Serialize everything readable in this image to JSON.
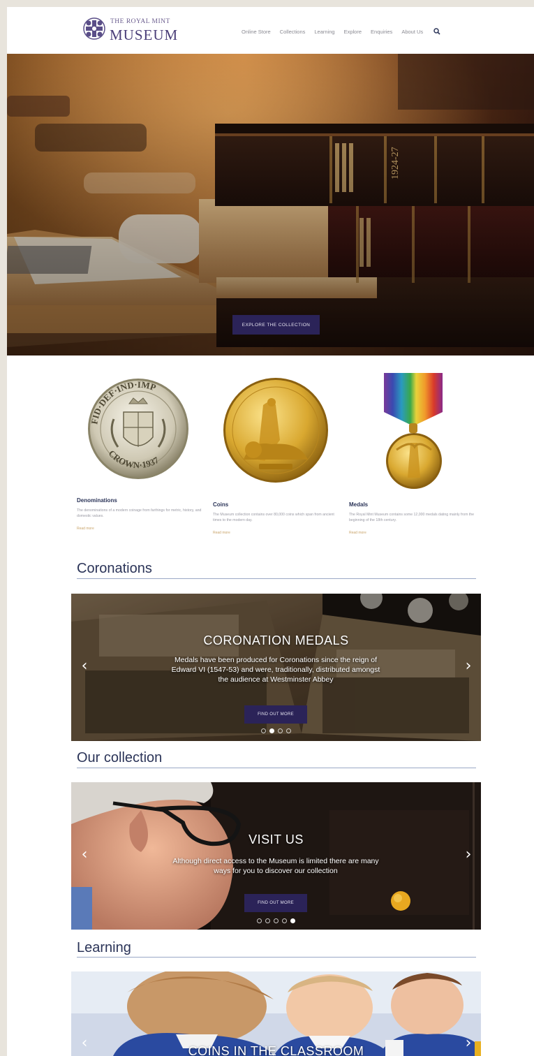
{
  "header": {
    "logo_small": "THE ROYAL MINT",
    "logo_big": "MUSEUM",
    "nav": [
      "Online Store",
      "Collections",
      "Learning",
      "Explore",
      "Enquiries",
      "About Us"
    ],
    "search_icon": "search-icon"
  },
  "hero": {
    "button_label": "EXPLORE THE COLLECTION",
    "book_spine_text": "1924-27"
  },
  "categories": [
    {
      "title": "Denominations",
      "description": "The denominations of a modern coinage from farthings for metric, history, and domestic values.",
      "more": "Read more",
      "coin_text": "FID·DEF·IND·IMP CROWN·1937"
    },
    {
      "title": "Coins",
      "description": "The Museum collection contains over 80,000 coins which span from ancient times to the modern day.",
      "more": "Read more"
    },
    {
      "title": "Medals",
      "description": "The Royal Mint Museum contains some 12,000 medals dating mainly from the beginning of the 18th century.",
      "more": "Read more"
    }
  ],
  "sections": {
    "coronations": {
      "title": "Coronations",
      "slide_title": "CORONATION MEDALS",
      "slide_text": "Medals have been produced for Coronations since the reign of Edward VI (1547-53) and were, traditionally, distributed amongst the audience at Westminster Abbey",
      "button_label": "FIND OUT MORE",
      "dots": 4,
      "active_dot": 1
    },
    "collection": {
      "title": "Our collection",
      "slide_title": "VISIT US",
      "slide_text": "Although direct access to the Museum is limited there are many ways for you to discover our collection",
      "button_label": "FIND OUT MORE",
      "dots": 5,
      "active_dot": 4
    },
    "learning": {
      "title": "Learning",
      "slide_title": "COINS IN THE CLASSROOM"
    }
  },
  "colors": {
    "brand": "#2b2358",
    "heading": "#2b3458",
    "accent": "#c9a46a"
  }
}
